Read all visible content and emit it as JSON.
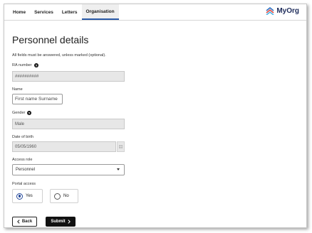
{
  "nav": {
    "tabs": [
      {
        "label": "Home"
      },
      {
        "label": "Services"
      },
      {
        "label": "Letters"
      },
      {
        "label": "Organisation"
      }
    ],
    "active_tab": "Organisation",
    "brand": "MyOrg"
  },
  "page": {
    "title": "Personnel details",
    "intro": "All fields must be answered, unless marked (optional)."
  },
  "form": {
    "ra_number": {
      "label": "RA number",
      "value": "##########"
    },
    "name": {
      "label": "Name",
      "value": "First name Surname"
    },
    "gender": {
      "label": "Gender",
      "value": "Male"
    },
    "dob": {
      "label": "Date of birth",
      "value": "05/05/1960"
    },
    "access_role": {
      "label": "Access role",
      "value": "Personnel"
    },
    "portal_access": {
      "label": "Portal access",
      "options": [
        {
          "label": "Yes",
          "checked": true
        },
        {
          "label": "No",
          "checked": false
        }
      ]
    }
  },
  "actions": {
    "back_label": "Back",
    "submit_label": "Submit"
  },
  "colors": {
    "accent": "#2a5aa8",
    "radio_checked": "#24489a",
    "submit_bg": "#111111",
    "readonly_bg": "#e7e7e7"
  }
}
